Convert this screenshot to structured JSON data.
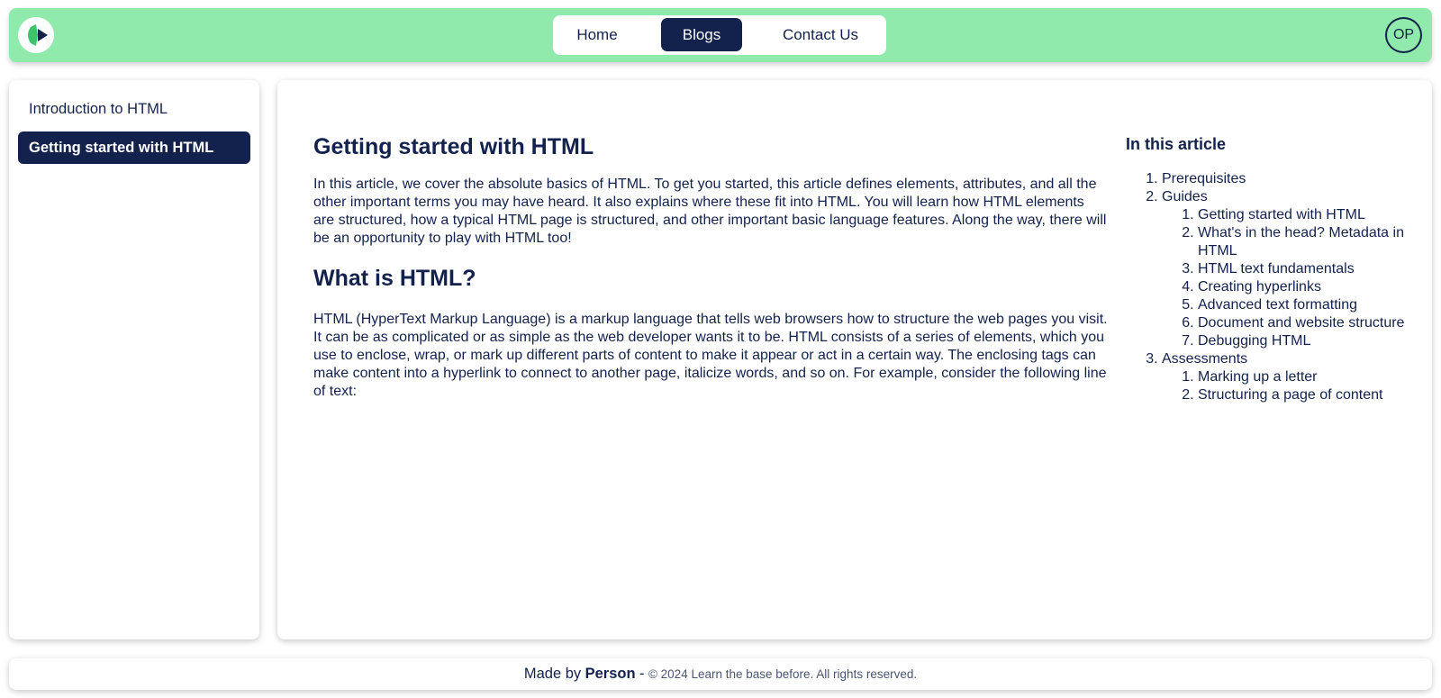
{
  "header": {
    "logo_icon": "play-leaf-logo-icon",
    "nav": [
      {
        "label": "Home",
        "active": false
      },
      {
        "label": "Blogs",
        "active": true
      },
      {
        "label": "Contact Us",
        "active": false
      }
    ],
    "avatar_initials": "OP"
  },
  "sidebar": {
    "items": [
      {
        "label": "Introduction to HTML",
        "active": false
      },
      {
        "label": "Getting started with HTML",
        "active": true
      }
    ]
  },
  "article": {
    "title": "Getting started with HTML",
    "intro": "In this article, we cover the absolute basics of HTML. To get you started, this article defines elements, attributes, and all the other important terms you may have heard. It also explains where these fit into HTML. You will learn how HTML elements are structured, how a typical HTML page is structured, and other important basic language features. Along the way, there will be an opportunity to play with HTML too!",
    "section_heading": "What is HTML?",
    "section_body": "HTML (HyperText Markup Language) is a markup language that tells web browsers how to structure the web pages you visit. It can be as complicated or as simple as the web developer wants it to be. HTML consists of a series of elements, which you use to enclose, wrap, or mark up different parts of content to make it appear or act in a certain way. The enclosing tags can make content into a hyperlink to connect to another page, italicize words, and so on. For example, consider the following line of text:"
  },
  "toc": {
    "title": "In this article",
    "items": [
      {
        "label": "Prerequisites"
      },
      {
        "label": "Guides",
        "children": [
          "Getting started with HTML",
          "What's in the head? Metadata in HTML",
          "HTML text fundamentals",
          "Creating hyperlinks",
          "Advanced text formatting",
          "Document and website structure",
          "Debugging HTML"
        ]
      },
      {
        "label": "Assessments",
        "children": [
          "Marking up a letter",
          "Structuring a page of content"
        ]
      }
    ]
  },
  "footer": {
    "made_by": "Made by",
    "author": "Person",
    "dash": "-",
    "copyright": "© 2024 Learn the base before. All rights reserved."
  },
  "colors": {
    "header_bg": "#8feaab",
    "primary": "#13224d",
    "surface": "#ffffff"
  }
}
